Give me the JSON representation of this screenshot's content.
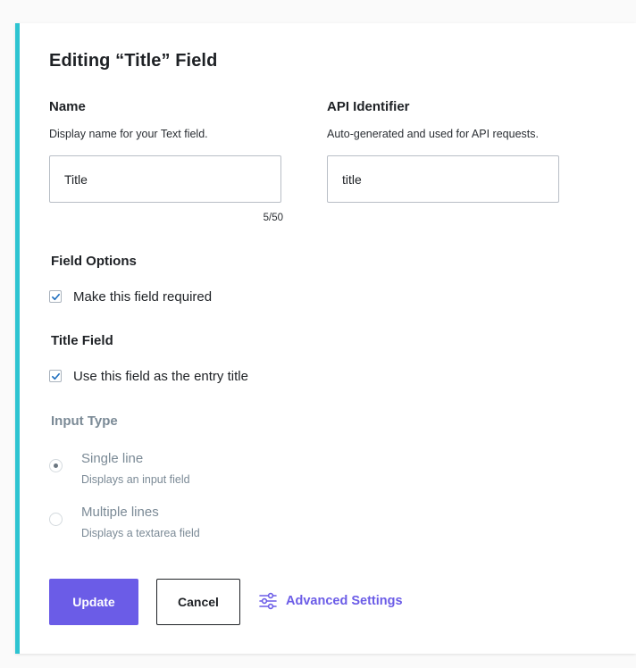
{
  "dialog": {
    "title": "Editing “Title” Field"
  },
  "name_field": {
    "label": "Name",
    "help": "Display name for your Text field.",
    "value": "Title",
    "counter": "5/50"
  },
  "api_field": {
    "label": "API Identifier",
    "help": "Auto-generated and used for API requests.",
    "value": "title"
  },
  "field_options": {
    "label": "Field Options",
    "required_label": "Make this field required",
    "required_checked": true
  },
  "title_field": {
    "label": "Title Field",
    "entry_title_label": "Use this field as the entry title",
    "entry_title_checked": true
  },
  "input_type": {
    "label": "Input Type",
    "options": [
      {
        "title": "Single line",
        "description": "Displays an input field",
        "selected": true
      },
      {
        "title": "Multiple lines",
        "description": "Displays a textarea field",
        "selected": false
      }
    ]
  },
  "actions": {
    "update_label": "Update",
    "cancel_label": "Cancel",
    "advanced_label": "Advanced Settings",
    "advanced_icon": "sliders-icon"
  },
  "colors": {
    "accent_bar": "#2ec4d1",
    "primary": "#6b5ce7",
    "checkmark": "#1f6fbf",
    "muted_text": "#7b8a96"
  }
}
